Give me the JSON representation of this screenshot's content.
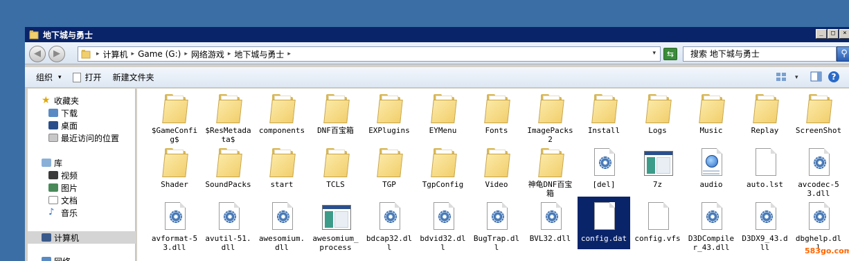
{
  "window": {
    "title": "地下城与勇士",
    "min_label": "_",
    "max_label": "□",
    "close_label": "×"
  },
  "nav": {
    "back_glyph": "◀",
    "forward_glyph": "▶",
    "breadcrumbs": [
      "计算机",
      "Game (G:)",
      "网络游戏",
      "地下城与勇士"
    ],
    "sep_glyph": "▸",
    "dropdown_glyph": "▾",
    "refresh_glyph": "⇆",
    "search_text": "搜索 地下城与勇士",
    "search_glyph": "⚲"
  },
  "toolbar": {
    "organize": "组织",
    "open": "打开",
    "new_folder": "新建文件夹",
    "arrow": "▾",
    "help_glyph": "?"
  },
  "sidebar": {
    "favorites": "收藏夹",
    "downloads": "下载",
    "desktop": "桌面",
    "recent": "最近访问的位置",
    "libraries": "库",
    "videos": "视频",
    "pictures": "图片",
    "documents": "文档",
    "music": "音乐",
    "computer": "计算机",
    "network": "网络"
  },
  "files": [
    {
      "name": "$GameConfig$",
      "type": "folder"
    },
    {
      "name": "$ResMetadata$",
      "type": "folder"
    },
    {
      "name": "components",
      "type": "folder"
    },
    {
      "name": "DNF百宝箱",
      "type": "folder"
    },
    {
      "name": "EXPlugins",
      "type": "folder"
    },
    {
      "name": "EYMenu",
      "type": "folder"
    },
    {
      "name": "Fonts",
      "type": "folder"
    },
    {
      "name": "ImagePacks2",
      "type": "folder"
    },
    {
      "name": "Install",
      "type": "folder"
    },
    {
      "name": "Logs",
      "type": "folder"
    },
    {
      "name": "Music",
      "type": "folder"
    },
    {
      "name": "Replay",
      "type": "folder"
    },
    {
      "name": "ScreenShot",
      "type": "folder"
    },
    {
      "name": "Shader",
      "type": "folder"
    },
    {
      "name": "SoundPacks",
      "type": "folder"
    },
    {
      "name": "start",
      "type": "folder"
    },
    {
      "name": "TCLS",
      "type": "folder"
    },
    {
      "name": "TGP",
      "type": "folder"
    },
    {
      "name": "TgpConfig",
      "type": "folder"
    },
    {
      "name": "Video",
      "type": "folder"
    },
    {
      "name": "神龟DNF百宝箱",
      "type": "folder"
    },
    {
      "name": "[del]",
      "type": "gear-app"
    },
    {
      "name": "7z",
      "type": "app"
    },
    {
      "name": "audio",
      "type": "web"
    },
    {
      "name": "auto.lst",
      "type": "doc"
    },
    {
      "name": "avcodec-53.dll",
      "type": "dll"
    },
    {
      "name": "avformat-53.dll",
      "type": "dll"
    },
    {
      "name": "avutil-51.dll",
      "type": "dll"
    },
    {
      "name": "awesomium.dll",
      "type": "dll"
    },
    {
      "name": "awesomium_process",
      "type": "app"
    },
    {
      "name": "bdcap32.dll",
      "type": "dll"
    },
    {
      "name": "bdvid32.dll",
      "type": "dll"
    },
    {
      "name": "BugTrap.dll",
      "type": "dll"
    },
    {
      "name": "BVL32.dll",
      "type": "dll"
    },
    {
      "name": "config.dat",
      "type": "doc",
      "selected": true
    },
    {
      "name": "config.vfs",
      "type": "doc"
    },
    {
      "name": "D3DCompiler_43.dll",
      "type": "dll"
    },
    {
      "name": "D3DX9_43.dll",
      "type": "dll"
    },
    {
      "name": "dbghelp.dll",
      "type": "dll"
    }
  ],
  "watermark": "583go.com"
}
